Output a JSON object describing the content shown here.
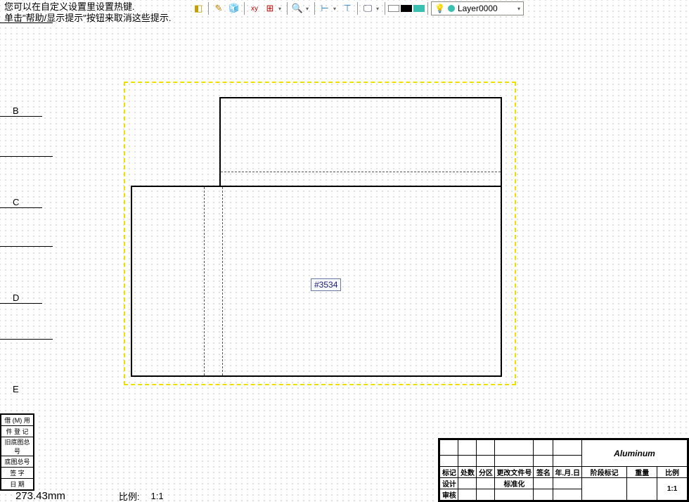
{
  "hints": {
    "line1": "您可以在自定义设置里设置热键.",
    "line2": "单击\"帮助/显示提示\"按钮来取消这些提示."
  },
  "layer": {
    "name": "Layer0000"
  },
  "left_markers": [
    "B",
    "C",
    "D",
    "E"
  ],
  "selection": {
    "label": "#3534"
  },
  "left_block": {
    "rows": [
      [
        "借 (M) 用",
        ""
      ],
      [
        "件 登 记",
        ""
      ],
      [
        "旧底图总号",
        ""
      ],
      [
        "底图总号",
        ""
      ],
      [
        "签 字",
        ""
      ],
      [
        "日 期",
        ""
      ]
    ]
  },
  "title_block": {
    "material": "Aluminum",
    "hdr": [
      "标记",
      "处数",
      "分区",
      "更改文件号",
      "签名",
      "年.月.日"
    ],
    "rows": [
      [
        "设计",
        "",
        "",
        "标准化",
        "",
        ""
      ],
      [
        "",
        "",
        "",
        "",
        "",
        ""
      ],
      [
        "审核",
        "",
        "",
        "",
        "",
        ""
      ]
    ],
    "right_hdr": [
      "阶段标记",
      "重量",
      "比例"
    ],
    "scale": "1:1"
  },
  "status": {
    "coord": "273.43mm",
    "scale_label": "比例:",
    "scale": "1:1"
  }
}
